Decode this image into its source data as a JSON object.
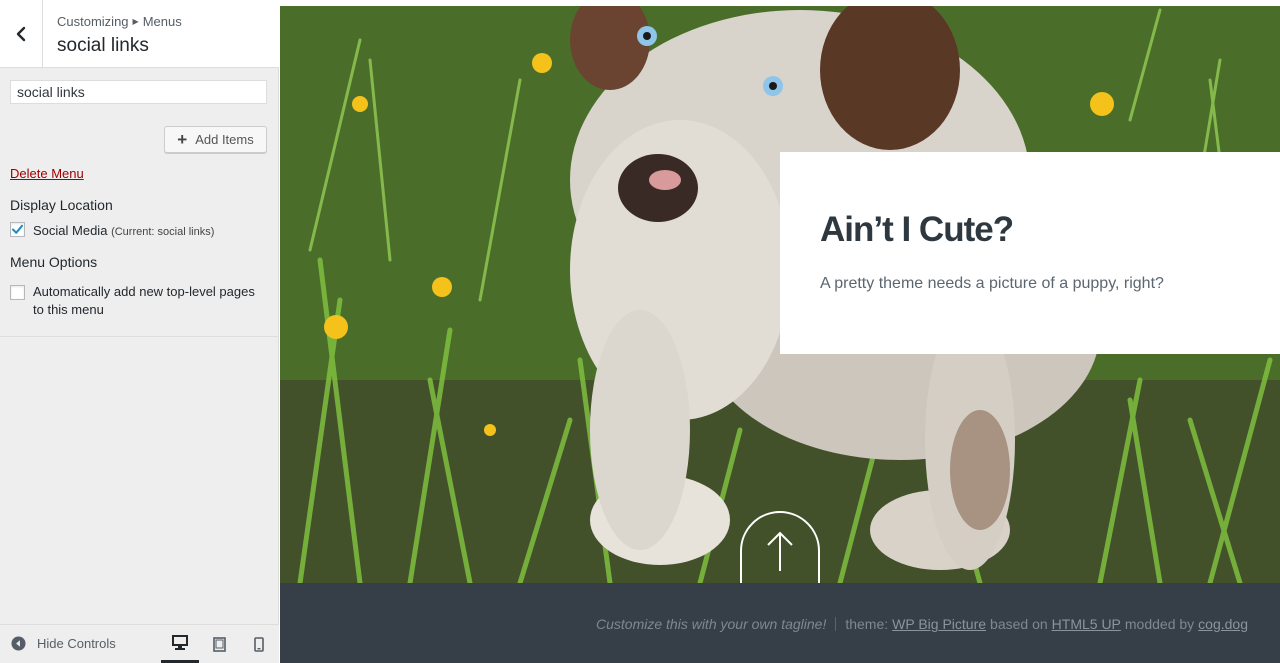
{
  "sidebar": {
    "breadcrumb": {
      "parent": "Customizing",
      "current": "Menus"
    },
    "title": "social links",
    "menu_name_value": "social links",
    "add_items_label": "Add Items",
    "delete_label": "Delete Menu",
    "display_location": {
      "heading": "Display Location",
      "option_label": "Social Media",
      "option_note": "(Current: social links)",
      "checked": true
    },
    "menu_options": {
      "heading": "Menu Options",
      "auto_add_label": "Automatically add new top-level pages to this menu",
      "checked": false
    },
    "footer": {
      "hide_controls_label": "Hide Controls",
      "devices": [
        "desktop-icon",
        "tablet-icon",
        "mobile-icon"
      ],
      "active_device": "desktop"
    }
  },
  "preview": {
    "hero_title": "Ain’t I Cute?",
    "hero_subtitle": "A pretty theme needs a picture of a puppy, right?",
    "footer": {
      "tagline": "Customize this with your own tagline!",
      "theme_prefix": "theme:",
      "theme_link": "WP Big Picture",
      "based_on": "based on",
      "html5up_link": "HTML5 UP",
      "modded_by": "modded by",
      "author_link": "cog.dog"
    }
  },
  "colors": {
    "sidebar_bg": "#eeeeee",
    "delete_link": "#a00000",
    "checkbox_check": "#1e8cbe",
    "footer_bg": "#363f47",
    "grass": "#4d7a2b"
  }
}
